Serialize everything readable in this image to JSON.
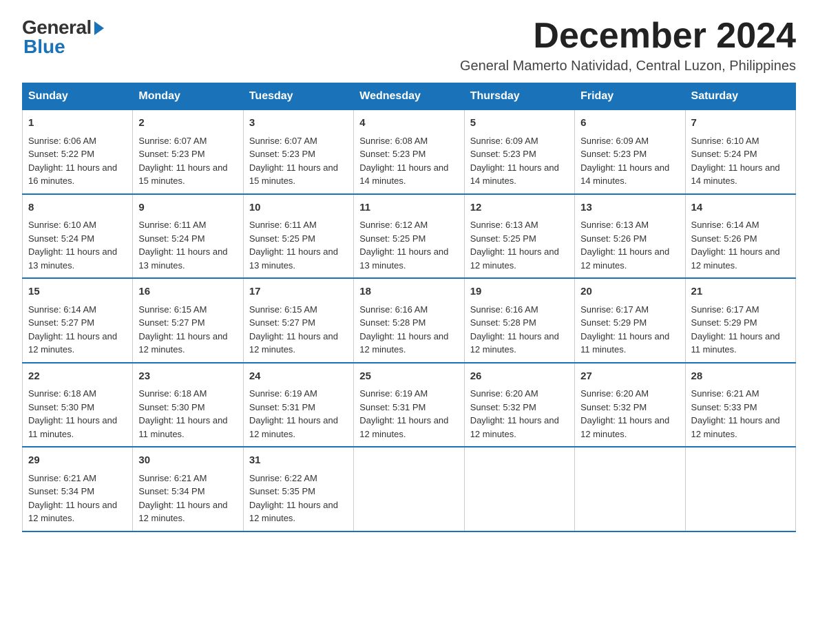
{
  "logo": {
    "text_general": "General",
    "text_blue": "Blue"
  },
  "header": {
    "month_title": "December 2024",
    "subtitle": "General Mamerto Natividad, Central Luzon, Philippines"
  },
  "weekdays": [
    "Sunday",
    "Monday",
    "Tuesday",
    "Wednesday",
    "Thursday",
    "Friday",
    "Saturday"
  ],
  "weeks": [
    [
      {
        "day": "1",
        "sunrise": "6:06 AM",
        "sunset": "5:22 PM",
        "daylight": "11 hours and 16 minutes."
      },
      {
        "day": "2",
        "sunrise": "6:07 AM",
        "sunset": "5:23 PM",
        "daylight": "11 hours and 15 minutes."
      },
      {
        "day": "3",
        "sunrise": "6:07 AM",
        "sunset": "5:23 PM",
        "daylight": "11 hours and 15 minutes."
      },
      {
        "day": "4",
        "sunrise": "6:08 AM",
        "sunset": "5:23 PM",
        "daylight": "11 hours and 14 minutes."
      },
      {
        "day": "5",
        "sunrise": "6:09 AM",
        "sunset": "5:23 PM",
        "daylight": "11 hours and 14 minutes."
      },
      {
        "day": "6",
        "sunrise": "6:09 AM",
        "sunset": "5:23 PM",
        "daylight": "11 hours and 14 minutes."
      },
      {
        "day": "7",
        "sunrise": "6:10 AM",
        "sunset": "5:24 PM",
        "daylight": "11 hours and 14 minutes."
      }
    ],
    [
      {
        "day": "8",
        "sunrise": "6:10 AM",
        "sunset": "5:24 PM",
        "daylight": "11 hours and 13 minutes."
      },
      {
        "day": "9",
        "sunrise": "6:11 AM",
        "sunset": "5:24 PM",
        "daylight": "11 hours and 13 minutes."
      },
      {
        "day": "10",
        "sunrise": "6:11 AM",
        "sunset": "5:25 PM",
        "daylight": "11 hours and 13 minutes."
      },
      {
        "day": "11",
        "sunrise": "6:12 AM",
        "sunset": "5:25 PM",
        "daylight": "11 hours and 13 minutes."
      },
      {
        "day": "12",
        "sunrise": "6:13 AM",
        "sunset": "5:25 PM",
        "daylight": "11 hours and 12 minutes."
      },
      {
        "day": "13",
        "sunrise": "6:13 AM",
        "sunset": "5:26 PM",
        "daylight": "11 hours and 12 minutes."
      },
      {
        "day": "14",
        "sunrise": "6:14 AM",
        "sunset": "5:26 PM",
        "daylight": "11 hours and 12 minutes."
      }
    ],
    [
      {
        "day": "15",
        "sunrise": "6:14 AM",
        "sunset": "5:27 PM",
        "daylight": "11 hours and 12 minutes."
      },
      {
        "day": "16",
        "sunrise": "6:15 AM",
        "sunset": "5:27 PM",
        "daylight": "11 hours and 12 minutes."
      },
      {
        "day": "17",
        "sunrise": "6:15 AM",
        "sunset": "5:27 PM",
        "daylight": "11 hours and 12 minutes."
      },
      {
        "day": "18",
        "sunrise": "6:16 AM",
        "sunset": "5:28 PM",
        "daylight": "11 hours and 12 minutes."
      },
      {
        "day": "19",
        "sunrise": "6:16 AM",
        "sunset": "5:28 PM",
        "daylight": "11 hours and 12 minutes."
      },
      {
        "day": "20",
        "sunrise": "6:17 AM",
        "sunset": "5:29 PM",
        "daylight": "11 hours and 11 minutes."
      },
      {
        "day": "21",
        "sunrise": "6:17 AM",
        "sunset": "5:29 PM",
        "daylight": "11 hours and 11 minutes."
      }
    ],
    [
      {
        "day": "22",
        "sunrise": "6:18 AM",
        "sunset": "5:30 PM",
        "daylight": "11 hours and 11 minutes."
      },
      {
        "day": "23",
        "sunrise": "6:18 AM",
        "sunset": "5:30 PM",
        "daylight": "11 hours and 11 minutes."
      },
      {
        "day": "24",
        "sunrise": "6:19 AM",
        "sunset": "5:31 PM",
        "daylight": "11 hours and 12 minutes."
      },
      {
        "day": "25",
        "sunrise": "6:19 AM",
        "sunset": "5:31 PM",
        "daylight": "11 hours and 12 minutes."
      },
      {
        "day": "26",
        "sunrise": "6:20 AM",
        "sunset": "5:32 PM",
        "daylight": "11 hours and 12 minutes."
      },
      {
        "day": "27",
        "sunrise": "6:20 AM",
        "sunset": "5:32 PM",
        "daylight": "11 hours and 12 minutes."
      },
      {
        "day": "28",
        "sunrise": "6:21 AM",
        "sunset": "5:33 PM",
        "daylight": "11 hours and 12 minutes."
      }
    ],
    [
      {
        "day": "29",
        "sunrise": "6:21 AM",
        "sunset": "5:34 PM",
        "daylight": "11 hours and 12 minutes."
      },
      {
        "day": "30",
        "sunrise": "6:21 AM",
        "sunset": "5:34 PM",
        "daylight": "11 hours and 12 minutes."
      },
      {
        "day": "31",
        "sunrise": "6:22 AM",
        "sunset": "5:35 PM",
        "daylight": "11 hours and 12 minutes."
      },
      null,
      null,
      null,
      null
    ]
  ]
}
